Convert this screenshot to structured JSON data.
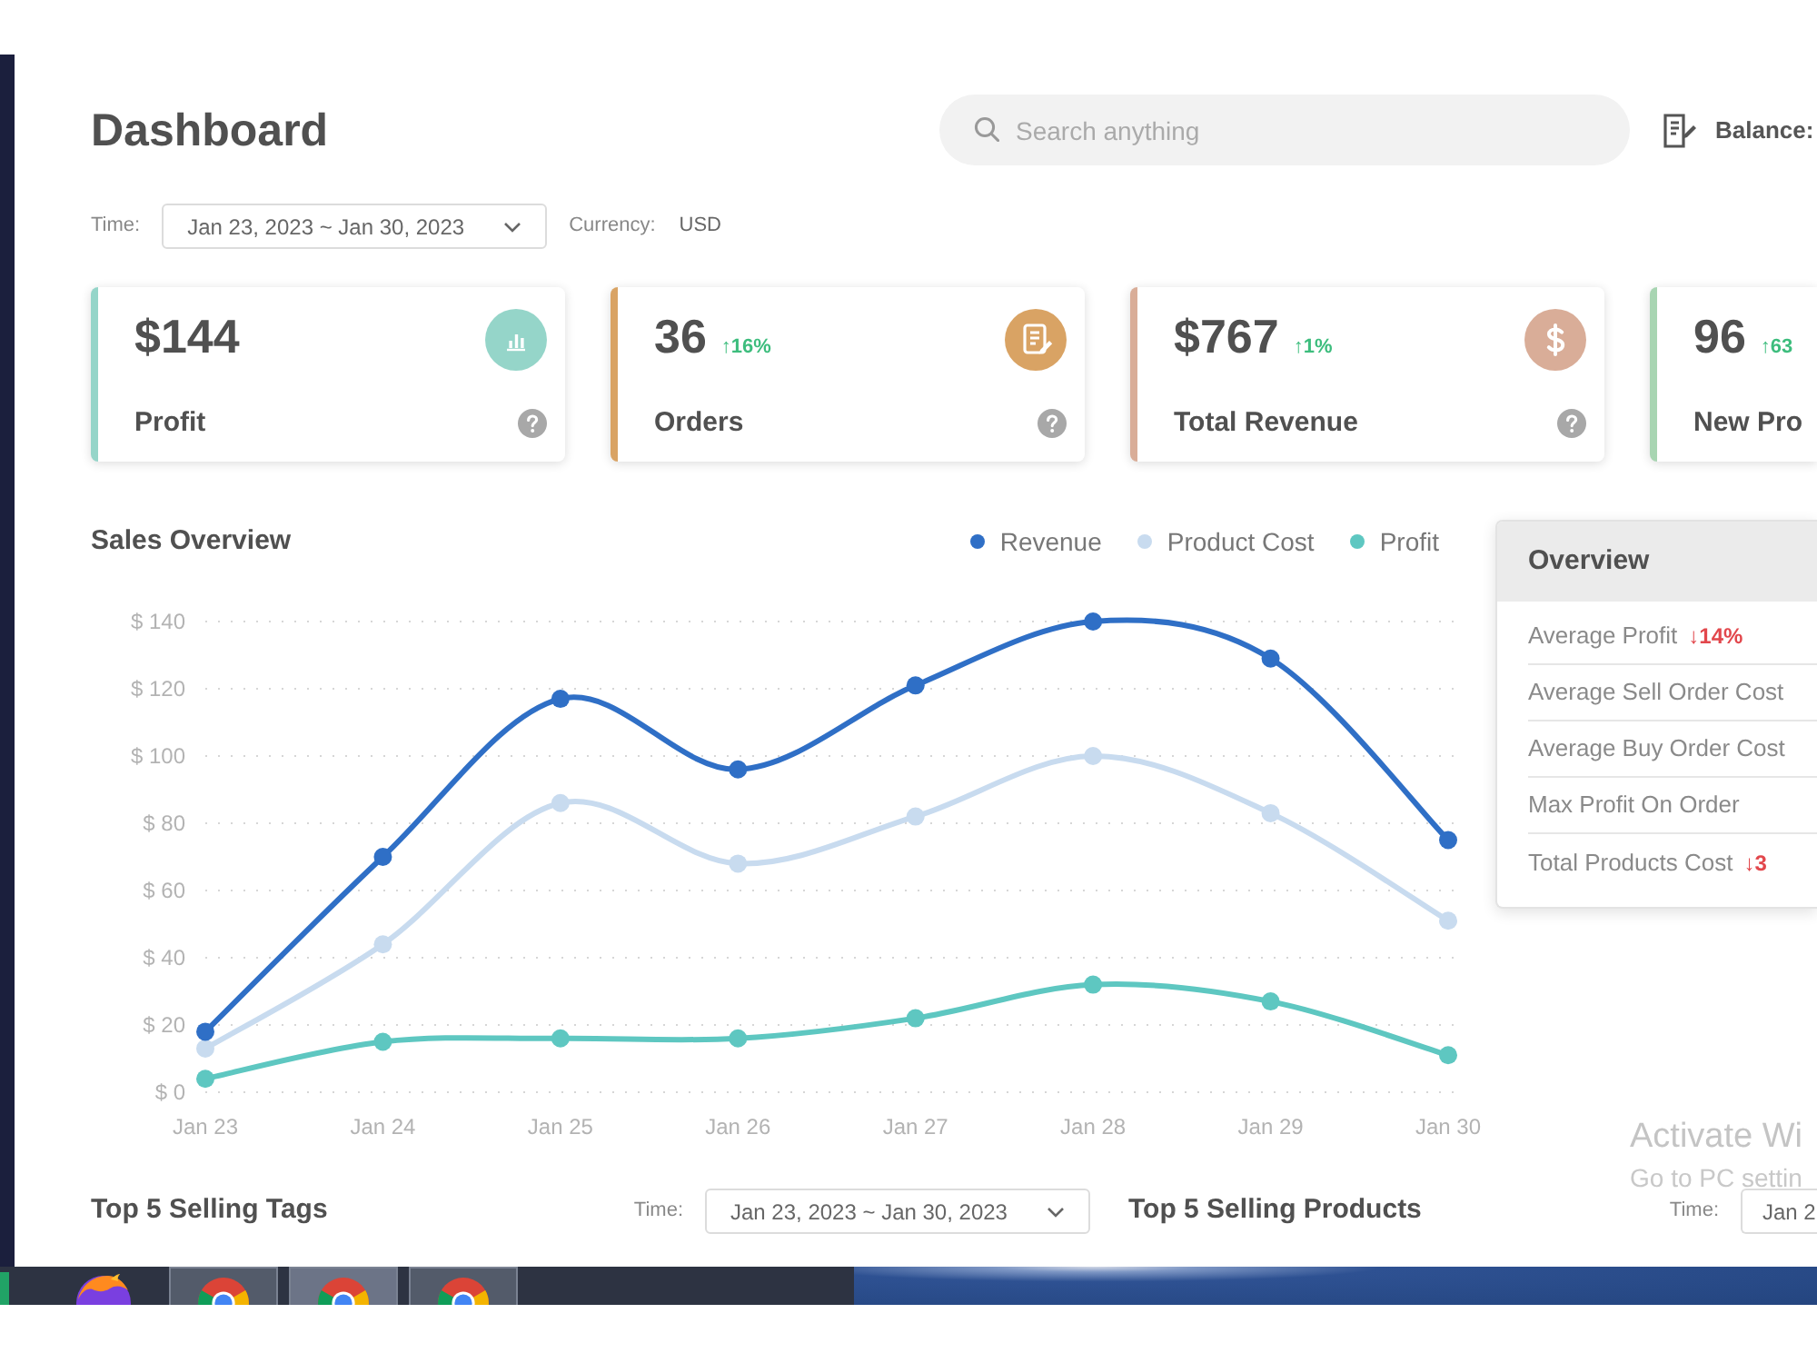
{
  "header": {
    "title": "Dashboard",
    "search": {
      "placeholder": "Search anything"
    },
    "balance_label": "Balance:"
  },
  "filters": {
    "time_label": "Time:",
    "date_range": "Jan 23, 2023 ~ Jan 30, 2023",
    "chevron": true,
    "currency_label": "Currency:",
    "currency": "USD"
  },
  "cards": [
    {
      "kind": "chart",
      "value": "$144",
      "label": "Profit",
      "color": "#95d5c9",
      "help": true
    },
    {
      "kind": "document",
      "value": "36",
      "change": "↑16%",
      "positive": true,
      "label": "Orders",
      "color": "#d9a364",
      "help": true
    },
    {
      "kind": "dollar",
      "value": "$767",
      "change": "↑1%",
      "positive": true,
      "label": "Total Revenue",
      "color": "#d9ad98",
      "help": true
    },
    {
      "kind": "cut",
      "value": "96",
      "change": "↑63",
      "positive": true,
      "label": "New Pro",
      "color": "#a8d5b2"
    }
  ],
  "sales_overview": {
    "chart_data": {
      "type": "line",
      "title": "Sales Overview",
      "categories": [
        "Jan 23",
        "Jan 24",
        "Jan 25",
        "Jan 26",
        "Jan 27",
        "Jan 28",
        "Jan 29",
        "Jan 30"
      ],
      "series": [
        {
          "name": "Revenue",
          "color": "#2f6fc6",
          "marker": "circle",
          "values": [
            18,
            70,
            117,
            96,
            121,
            140,
            129,
            75
          ]
        },
        {
          "name": "Product Cost",
          "color": "#c8dbef",
          "marker": "circle",
          "values": [
            13,
            44,
            86,
            68,
            82,
            100,
            83,
            51
          ]
        },
        {
          "name": "Profit",
          "color": "#5ec7c1",
          "marker": "circle",
          "values": [
            4,
            15,
            16,
            16,
            22,
            32,
            27,
            11
          ]
        }
      ],
      "ylim": [
        0,
        140
      ],
      "grid": true,
      "yticks": [
        {
          "value": 0,
          "label": "$ 0"
        },
        {
          "value": 20,
          "label": "$ 20"
        },
        {
          "value": 40,
          "label": "$ 40"
        },
        {
          "value": 60,
          "label": "$ 60"
        },
        {
          "value": 80,
          "label": "$ 80"
        },
        {
          "value": 100,
          "label": "$ 100"
        },
        {
          "value": 120,
          "label": "$ 120"
        },
        {
          "value": 140,
          "label": "$ 140"
        }
      ]
    }
  },
  "overview": {
    "title": "Overview",
    "rows": [
      {
        "label": "Average Profit",
        "change": "↓14%",
        "positive": false
      },
      {
        "label": "Average Sell Order Cost"
      },
      {
        "label": "Average Buy Order Cost"
      },
      {
        "label": "Max Profit On Order"
      },
      {
        "label": "Total Products Cost",
        "change": "↓3",
        "positive": false
      }
    ]
  },
  "top_selling_tags": {
    "title": "Top 5 Selling Tags",
    "time_label": "Time:",
    "date_range": "Jan 23, 2023 ~ Jan 30, 2023",
    "chevron": true
  },
  "top_selling_products": {
    "title": "Top 5 Selling Products",
    "time_label": "Time:",
    "date_range": "Jan 2"
  },
  "activation_notice": {
    "title": "Activate Wi",
    "subtitle": "Go to PC settin"
  },
  "taskbar": {
    "items": [
      {
        "kind": "tile",
        "selected": false
      },
      {
        "kind": "firefox",
        "open": false,
        "selected": false
      },
      {
        "kind": "chrome",
        "open": true,
        "selected": false
      },
      {
        "kind": "chrome",
        "open": true,
        "selected": true
      },
      {
        "kind": "chrome",
        "open": true,
        "selected": false
      }
    ]
  }
}
